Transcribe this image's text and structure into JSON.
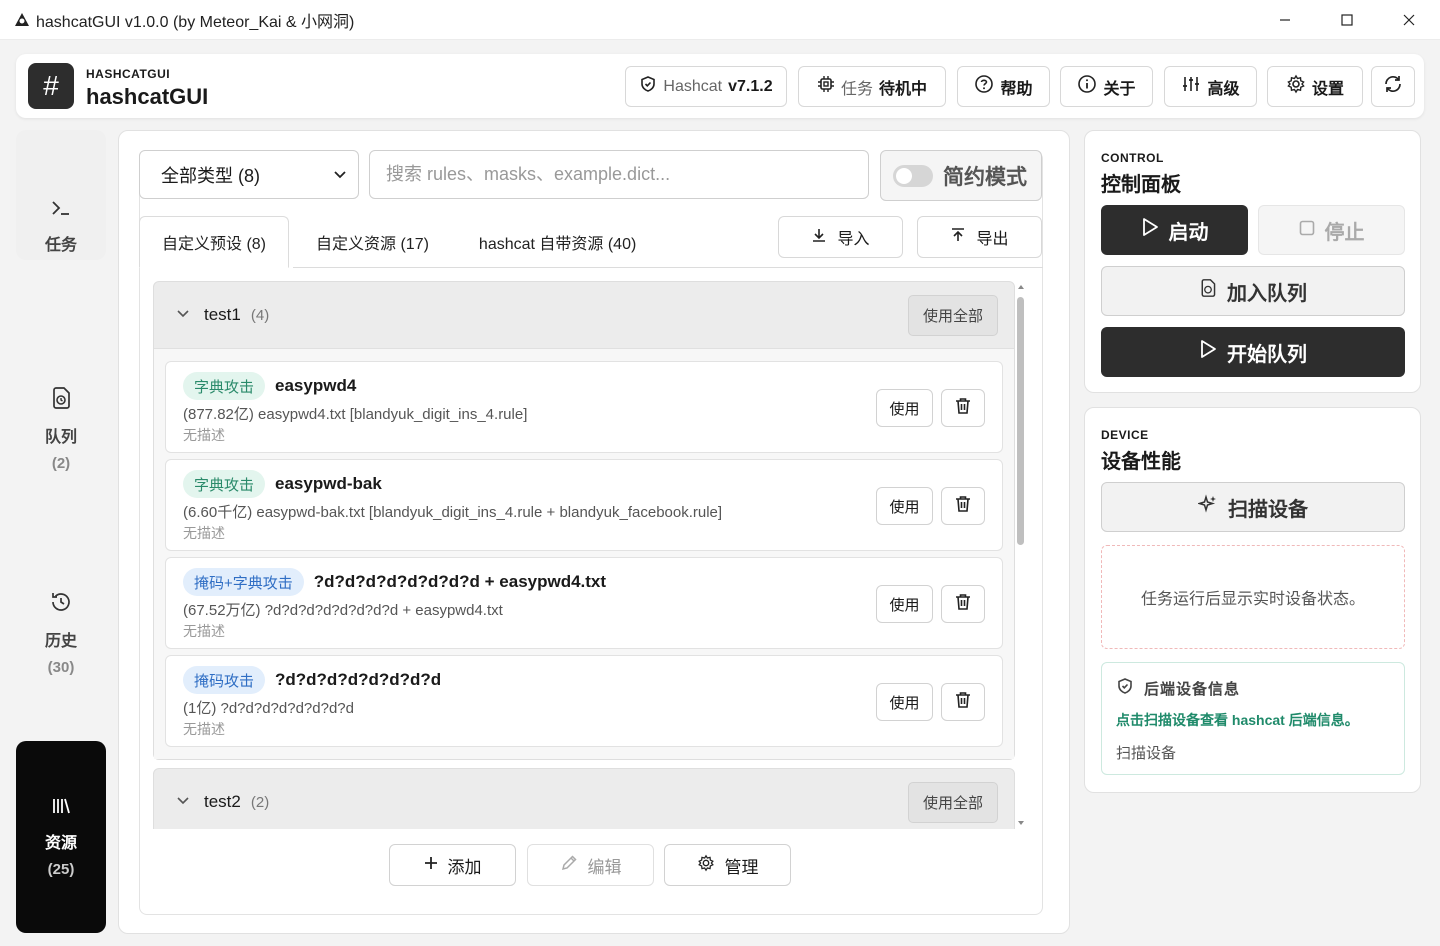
{
  "window": {
    "title": "hashcatGUI v1.0.0 (by Meteor_Kai & 小网洞)",
    "minimize_icon": "minimize-icon",
    "maximize_icon": "maximize-icon",
    "close_icon": "close-icon"
  },
  "header": {
    "brand_small": "HASHCATGUI",
    "brand_big": "hashcatGUI",
    "logo_glyph": "#",
    "hashcat_label": "Hashcat",
    "hashcat_version": "v7.1.2",
    "task_label": "任务",
    "task_status": "待机中",
    "help_label": "帮助",
    "about_label": "关于",
    "advanced_label": "高级",
    "settings_label": "设置"
  },
  "sidebar": {
    "items": [
      {
        "label": "任务",
        "count": "",
        "icon": "terminal-icon"
      },
      {
        "label": "队列",
        "count": "(2)",
        "icon": "queue-icon"
      },
      {
        "label": "历史",
        "count": "(30)",
        "icon": "history-icon"
      },
      {
        "label": "资源",
        "count": "(25)",
        "icon": "library-icon"
      }
    ]
  },
  "main": {
    "type_select": "全部类型 (8)",
    "search_placeholder": "搜索 rules、masks、example.dict...",
    "compact_mode_label": "简约模式",
    "tabs": [
      {
        "label": "自定义预设 (8)"
      },
      {
        "label": "自定义资源 (17)"
      },
      {
        "label": "hashcat 自带资源 (40)"
      }
    ],
    "import_label": "导入",
    "export_label": "导出",
    "groups": [
      {
        "name": "test1",
        "count": "(4)",
        "use_all_label": "使用全部",
        "cards": [
          {
            "tag": "字典攻击",
            "tag_type": "dict",
            "name": "easypwd4",
            "desc": "(877.82亿) easypwd4.txt [blandyuk_digit_ins_4.rule]",
            "note": "无描述",
            "use_label": "使用"
          },
          {
            "tag": "字典攻击",
            "tag_type": "dict",
            "name": "easypwd-bak",
            "desc": "(6.60千亿) easypwd-bak.txt [blandyuk_digit_ins_4.rule + blandyuk_facebook.rule]",
            "note": "无描述",
            "use_label": "使用"
          },
          {
            "tag": "掩码+字典攻击",
            "tag_type": "mask",
            "name": "?d?d?d?d?d?d?d?d + easypwd4.txt",
            "desc": "(67.52万亿) ?d?d?d?d?d?d?d?d + easypwd4.txt",
            "note": "无描述",
            "use_label": "使用"
          },
          {
            "tag": "掩码攻击",
            "tag_type": "mask",
            "name": "?d?d?d?d?d?d?d?d",
            "desc": "(1亿) ?d?d?d?d?d?d?d?d",
            "note": "无描述",
            "use_label": "使用"
          }
        ]
      },
      {
        "name": "test2",
        "count": "(2)",
        "use_all_label": "使用全部",
        "cards": []
      }
    ],
    "add_label": "添加",
    "edit_label": "编辑",
    "manage_label": "管理"
  },
  "control": {
    "tag": "CONTROL",
    "title": "控制面板",
    "start_label": "启动",
    "stop_label": "停止",
    "enqueue_label": "加入队列",
    "start_queue_label": "开始队列"
  },
  "device": {
    "tag": "DEVICE",
    "title": "设备性能",
    "scan_label": "扫描设备",
    "placeholder": "任务运行后显示实时设备状态。",
    "backend_title": "后端设备信息",
    "backend_link": "点击扫描设备查看 hashcat 后端信息。",
    "backend_sub": "扫描设备"
  },
  "colors": {
    "accent_dark": "#2d2d2d",
    "dict_tag": "#2a8a6a",
    "mask_tag": "#2f6ec4",
    "link_green": "#1f8a6a"
  }
}
